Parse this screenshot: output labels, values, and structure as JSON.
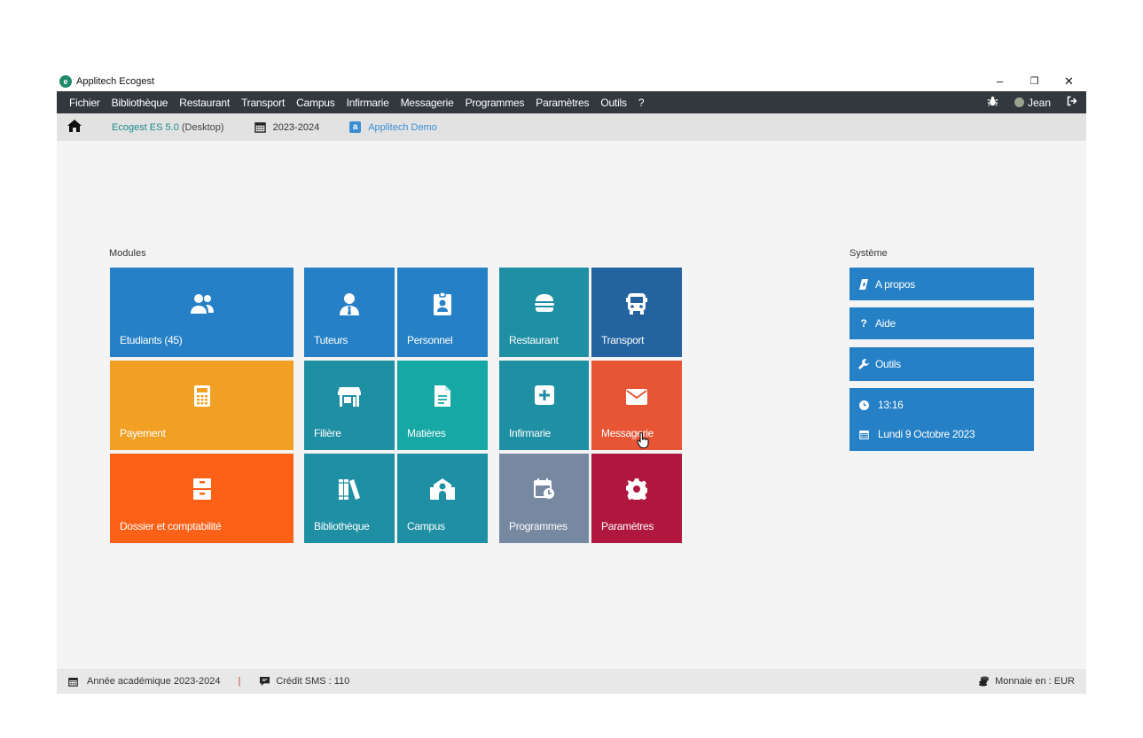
{
  "window": {
    "title": "Applitech Ecogest",
    "minimize": "–",
    "restore": "❐",
    "close": "✕"
  },
  "menu": {
    "items": [
      "Fichier",
      "Bibliothèque",
      "Restaurant",
      "Transport",
      "Campus",
      "Infirmarie",
      "Messagerie",
      "Programmes",
      "Paramètres",
      "Outils",
      "?"
    ],
    "user": "Jean"
  },
  "infobar": {
    "version_name": "Ecogest ES 5.0",
    "version_suffix": "(Desktop)",
    "year": "2023-2024",
    "demo": "Applitech Demo"
  },
  "modules": {
    "label": "Modules",
    "tiles": [
      {
        "label": "Etudiants  (45)",
        "icon": "users-icon",
        "color": "#2580c6"
      },
      {
        "label": "Tuteurs",
        "icon": "user-tie-icon",
        "color": "#2580c6"
      },
      {
        "label": "Personnel",
        "icon": "id-badge-icon",
        "color": "#2580c6"
      },
      {
        "label": "Restaurant",
        "icon": "hamburger-icon",
        "color": "#1f8fa3"
      },
      {
        "label": "Transport",
        "icon": "bus-icon",
        "color": "#23639f"
      },
      {
        "label": "Payement",
        "icon": "calculator-icon",
        "color": "#f2a024"
      },
      {
        "label": "Filière",
        "icon": "store-icon",
        "color": "#1f8fa3"
      },
      {
        "label": "Matières",
        "icon": "file-icon",
        "color": "#15a8a5"
      },
      {
        "label": "Infirmarie",
        "icon": "plus-square-icon",
        "color": "#1f8fa3"
      },
      {
        "label": "Messagerie",
        "icon": "envelope-icon",
        "color": "#e85535"
      },
      {
        "label": "Dossier et comptabilité",
        "icon": "archive-icon",
        "color": "#fd6117"
      },
      {
        "label": "Bibliothèque",
        "icon": "books-icon",
        "color": "#1f8fa3"
      },
      {
        "label": "Campus",
        "icon": "school-icon",
        "color": "#1f8fa3"
      },
      {
        "label": "Programmes",
        "icon": "calendar-clock-icon",
        "color": "#7789a0"
      },
      {
        "label": "Paramètres",
        "icon": "gear-icon",
        "color": "#b0173f"
      }
    ]
  },
  "system": {
    "label": "Système",
    "about": "A propos",
    "help": "Aide",
    "tools": "Outils",
    "time": "13:16",
    "date": "Lundi 9 Octobre 2023"
  },
  "status": {
    "academic_year": "Année académique 2023-2024",
    "separator": "|",
    "sms_credit": "Crédit SMS : 110",
    "currency": "Monnaie en : EUR"
  }
}
